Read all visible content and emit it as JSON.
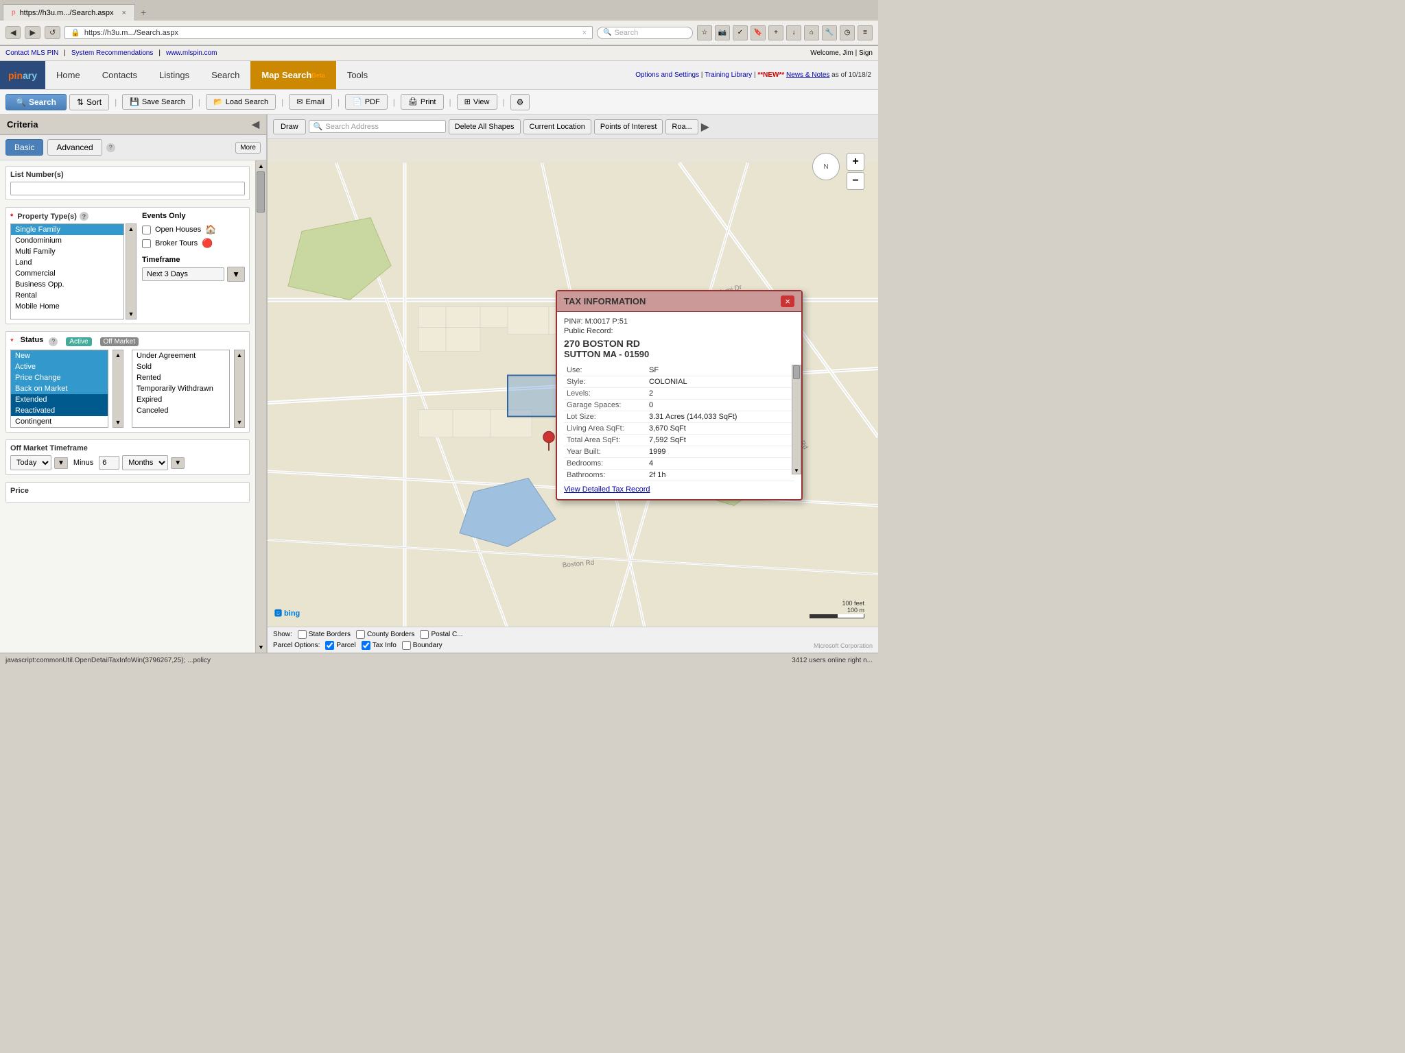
{
  "browser": {
    "tab_url": "https://h3u.m.../Search.aspx",
    "tab_close": "×",
    "tab_new": "+",
    "address": "https://h3u.m.../Search.aspx",
    "address_display": "https://h3u.m.../Search.aspx",
    "search_placeholder": "Search"
  },
  "info_bar": {
    "contact": "Contact MLS PIN",
    "sep1": "|",
    "system": "System Recommendations",
    "sep2": "|",
    "website": "www.mlspin.com",
    "welcome": "Welcome, Jim | Sign",
    "options": "Options and Settings",
    "training": "Training Library",
    "new_label": "**NEW**",
    "news": "News & Notes",
    "news_date": "as of 10/18/2"
  },
  "nav": {
    "logo_pin": "pin",
    "logo_ary": "ary",
    "items": [
      {
        "label": "Home",
        "active": false
      },
      {
        "label": "Contacts",
        "active": false
      },
      {
        "label": "Listings",
        "active": false
      },
      {
        "label": "Search",
        "active": false
      },
      {
        "label": "Map Search",
        "active": true,
        "beta": "Beta"
      },
      {
        "label": "Tools",
        "active": false
      }
    ]
  },
  "toolbar": {
    "search_label": "Search",
    "sort_label": "Sort",
    "save_search_label": "Save Search",
    "load_search_label": "Load Search",
    "email_label": "Email",
    "pdf_label": "PDF",
    "print_label": "Print",
    "view_label": "View"
  },
  "sidebar": {
    "title": "Criteria",
    "tab_basic": "Basic",
    "tab_advanced": "Advanced",
    "tab_more": "More",
    "list_number_label": "List Number(s)",
    "list_number_placeholder": "",
    "property_type_label": "Property Type(s)",
    "property_types": [
      {
        "label": "Single Family",
        "selected": true
      },
      {
        "label": "Condominium",
        "selected": false
      },
      {
        "label": "Multi Family",
        "selected": false
      },
      {
        "label": "Land",
        "selected": false
      },
      {
        "label": "Commercial",
        "selected": false
      },
      {
        "label": "Business Opp.",
        "selected": false
      },
      {
        "label": "Rental",
        "selected": false
      },
      {
        "label": "Mobile Home",
        "selected": false
      }
    ],
    "events_only_label": "Events Only",
    "open_houses_label": "Open Houses",
    "broker_tours_label": "Broker Tours",
    "timeframe_label": "Timeframe",
    "timeframe_value": "Next 3 Days",
    "status_label": "Status",
    "active_label": "Active",
    "off_market_label": "Off Market",
    "active_statuses": [
      {
        "label": "New",
        "selected": true
      },
      {
        "label": "Active",
        "selected": true
      },
      {
        "label": "Price Change",
        "selected": true
      },
      {
        "label": "Back on Market",
        "selected": true
      },
      {
        "label": "Extended",
        "selected": true
      },
      {
        "label": "Reactivated",
        "selected": true
      },
      {
        "label": "Contingent",
        "selected": false
      }
    ],
    "off_market_statuses": [
      {
        "label": "Under Agreement",
        "selected": false
      },
      {
        "label": "Sold",
        "selected": false
      },
      {
        "label": "Rented",
        "selected": false
      },
      {
        "label": "Temporarily Withdrawn",
        "selected": false
      },
      {
        "label": "Expired",
        "selected": false
      },
      {
        "label": "Canceled",
        "selected": false
      }
    ],
    "off_market_timeframe_label": "Off Market Timeframe",
    "off_market_tf_value": "Today",
    "off_market_tf_minus": "Minus",
    "off_market_tf_number": "6",
    "off_market_tf_unit": "Months",
    "price_label": "Price"
  },
  "map_toolbar": {
    "draw_label": "Draw",
    "search_address_placeholder": "Search Address",
    "delete_shapes_label": "Delete All Shapes",
    "current_location_label": "Current Location",
    "poi_label": "Points of Interest",
    "road_label": "Roa..."
  },
  "tax_popup": {
    "title": "TAX INFORMATION",
    "pin": "PIN#: M:0017 P:51",
    "public_record": "Public Record:",
    "address": "270 BOSTON RD",
    "city": "SUTTON MA - 01590",
    "fields": [
      {
        "label": "Use:",
        "value": "SF"
      },
      {
        "label": "Style:",
        "value": "COLONIAL"
      },
      {
        "label": "Levels:",
        "value": "2"
      },
      {
        "label": "Garage Spaces:",
        "value": "0"
      },
      {
        "label": "Lot Size:",
        "value": "3.31 Acres (144,033 SqFt)"
      },
      {
        "label": "Living Area SqFt:",
        "value": "3,670 SqFt"
      },
      {
        "label": "Total Area SqFt:",
        "value": "7,592 SqFt"
      },
      {
        "label": "Year Built:",
        "value": "1999"
      },
      {
        "label": "Bedrooms:",
        "value": "4"
      },
      {
        "label": "Bathrooms:",
        "value": "2f 1h"
      }
    ],
    "link": "View Detailed Tax Record"
  },
  "map_bottom": {
    "show_label": "Show:",
    "state_borders": "State Borders",
    "county_borders": "County Borders",
    "postal_c": "Postal C...",
    "parcel_options": "Parcel Options:",
    "parcel": "Parcel",
    "tax_info": "Tax Info",
    "boundary": "Boundary"
  },
  "status_bar": {
    "url": "javascript:commonUtil.OpenDetailTaxInfoWin(3796267,25); ...policy",
    "users": "3412 users online right n..."
  }
}
